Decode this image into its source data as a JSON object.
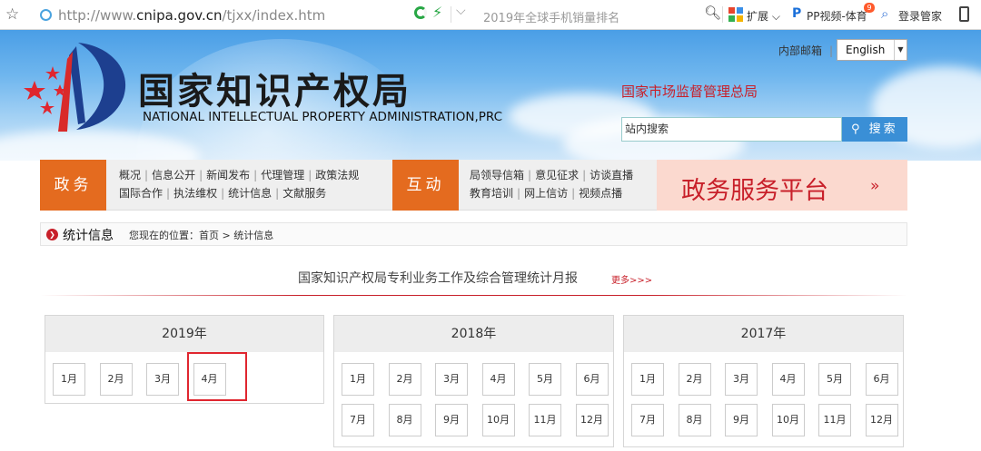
{
  "browser": {
    "url_prefix": "http://www.",
    "url_domain": "cnipa.gov.cn",
    "url_path": "/tjxx/index.htm",
    "search_hint": "2019年全球手机销量排名",
    "extensions_label": "扩展",
    "pp_label": "PP视频-体育",
    "pp_badge": "9",
    "login_label": "登录管家"
  },
  "header": {
    "logo_cn": "国家知识产权局",
    "logo_en": "NATIONAL INTELLECTUAL PROPERTY ADMINISTRATION,PRC",
    "mailbox_link": "内部邮箱",
    "language_selected": "English",
    "samr_link": "国家市场监督管理总局",
    "search_placeholder": "站内搜索",
    "search_button": "搜索"
  },
  "nav": {
    "tab_affairs": "政务",
    "affairs_row1": [
      "概况",
      "信息公开",
      "新闻发布",
      "代理管理",
      "政策法规"
    ],
    "affairs_row2": [
      "国际合作",
      "执法维权",
      "统计信息",
      "文献服务"
    ],
    "tab_interact": "互动",
    "interact_row1": [
      "局领导信箱",
      "意见征求",
      "访谈直播"
    ],
    "interact_row2": [
      "教育培训",
      "网上信访",
      "视频点播"
    ],
    "platform": "政务服务平台",
    "platform_chevron": "»"
  },
  "breadcrumb": {
    "title": "统计信息",
    "location_prefix": "您现在的位置：",
    "home": "首页",
    "separator": ">",
    "current": "统计信息"
  },
  "section": {
    "title": "国家知识产权局专利业务工作及综合管理统计月报",
    "more": "更多>>>"
  },
  "years": [
    {
      "year": "2019年",
      "months": [
        "1月",
        "2月",
        "3月",
        "4月"
      ],
      "highlighted": "4月"
    },
    {
      "year": "2018年",
      "months": [
        "1月",
        "2月",
        "3月",
        "4月",
        "5月",
        "6月",
        "7月",
        "8月",
        "9月",
        "10月",
        "11月",
        "12月"
      ]
    },
    {
      "year": "2017年",
      "months": [
        "1月",
        "2月",
        "3月",
        "4月",
        "5月",
        "6月",
        "7月",
        "8月",
        "9月",
        "10月",
        "11月",
        "12月"
      ]
    }
  ],
  "colors": {
    "accent_orange": "#e46b1f",
    "accent_red": "#c8202a",
    "header_blue": "#4a9ee6",
    "search_button_blue": "#3a8fd6"
  }
}
